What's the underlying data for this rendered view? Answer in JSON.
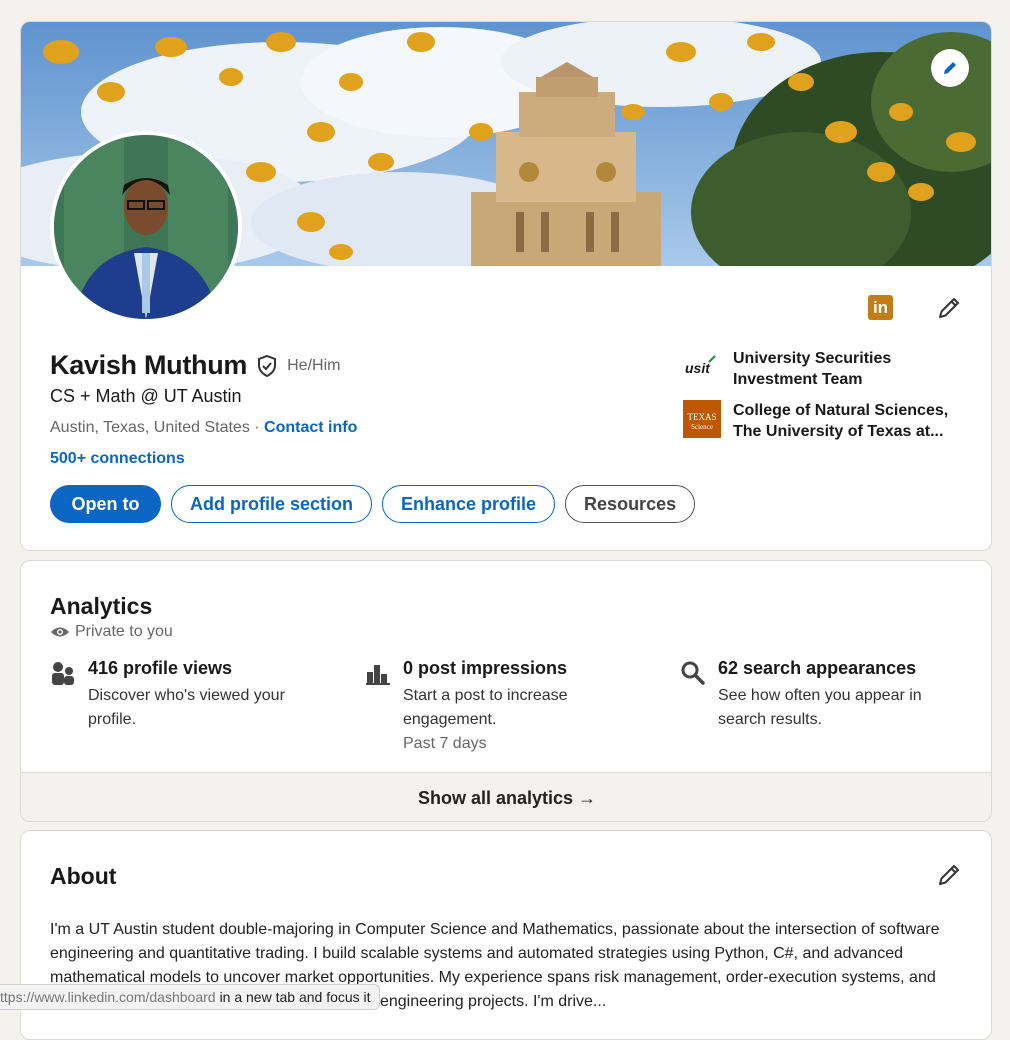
{
  "profile": {
    "name": "Kavish Muthum",
    "pronouns": "He/Him",
    "headline": "CS + Math @ UT Austin",
    "location": "Austin, Texas, United States",
    "location_separator": " · ",
    "contact_info": "Contact info",
    "connections": "500+ connections",
    "badge_letter": "in",
    "buttons": {
      "open_to": "Open to",
      "add_section": "Add profile section",
      "enhance": "Enhance profile",
      "resources": "Resources"
    },
    "experience": [
      {
        "logo_text": "usit",
        "name": "University Securities Investment Team"
      },
      {
        "logo_text": "TEXAS Science",
        "name": "College of Natural Sciences, The University of Texas at..."
      }
    ]
  },
  "analytics": {
    "title": "Analytics",
    "privacy": "Private to you",
    "metrics": [
      {
        "icon": "people-icon",
        "title": "416 profile views",
        "desc": "Discover who's viewed your profile."
      },
      {
        "icon": "bar-chart-icon",
        "title": "0 post impressions",
        "desc": "Start a post to increase engagement.",
        "foot": "Past 7 days"
      },
      {
        "icon": "search-icon",
        "title": "62 search appearances",
        "desc": "See how often you appear in search results."
      }
    ],
    "show_all": "Show all analytics →"
  },
  "about": {
    "title": "About",
    "text": "I'm a UT Austin student double-majoring in Computer Science and Mathematics, passionate about the intersection of software engineering and quantitative trading. I build scalable systems and automated strategies using Python, C#, and advanced mathematical models to uncover market opportunities. My experience spans risk management, order-execution systems, and trading bots, alongside infrastructure and data engineering projects. I'm drive..."
  },
  "status_bar": {
    "url": "ttps://www.linkedin.com/dashboard",
    "message": "in a new tab and focus it"
  },
  "colors": {
    "accent": "#0a66c2",
    "background": "#f4f2ee",
    "linkedin_badge": "#c37d16"
  }
}
